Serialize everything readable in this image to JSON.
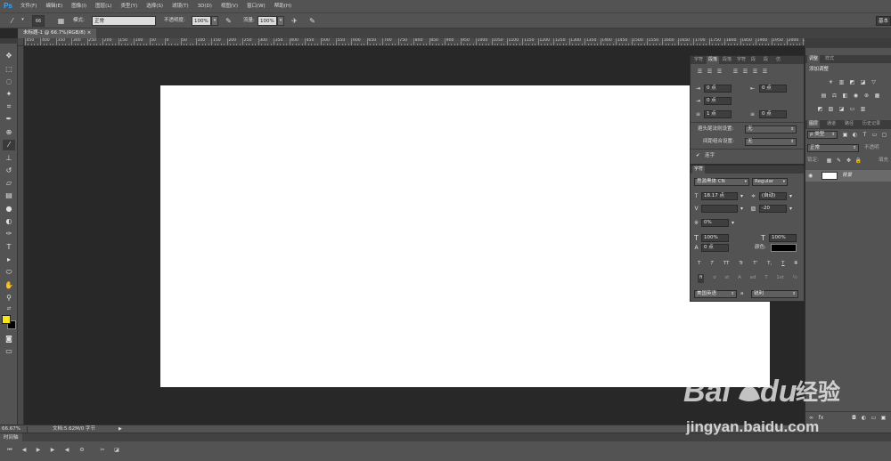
{
  "app": {
    "logo": "Ps"
  },
  "menu": [
    "文件(F)",
    "编辑(E)",
    "图像(I)",
    "图层(L)",
    "类型(Y)",
    "选择(S)",
    "滤镜(T)",
    "3D(D)",
    "视图(V)",
    "窗口(W)",
    "帮助(H)"
  ],
  "options_bar": {
    "brush_size": "66",
    "mode_label": "模式:",
    "mode_value": "正常",
    "opacity_label": "不透明度:",
    "opacity_value": "100%",
    "flow_label": "流量:",
    "flow_value": "100%",
    "workspace_button": "基本"
  },
  "document": {
    "tab_label": "未标题-1 @ 66.7%(RGB/8)",
    "zoom": "66.67%",
    "doc_info": "文档:5.62M/0 字节"
  },
  "ruler": {
    "labels": [
      "450",
      "400",
      "350",
      "300",
      "250",
      "200",
      "150",
      "100",
      "50",
      "0",
      "50",
      "100",
      "150",
      "200",
      "250",
      "300",
      "350",
      "400",
      "450",
      "500",
      "550",
      "600",
      "650",
      "700",
      "750",
      "800",
      "850",
      "900",
      "950",
      "1000",
      "1050",
      "1100",
      "1150",
      "1200",
      "1250",
      "1300",
      "1350",
      "1400",
      "1450",
      "1500",
      "1550",
      "1600",
      "1650",
      "1700",
      "1750",
      "1800",
      "1850",
      "1900",
      "1950",
      "2000",
      "2050",
      "2100",
      "2150",
      "2200",
      "2250",
      "2300"
    ]
  },
  "timeline": {
    "tab": "时间轴"
  },
  "paragraph_panel": {
    "tabs": [
      "字符",
      "段落",
      "段落",
      "字符",
      "段",
      "段",
      "仿"
    ],
    "indent_left": "0 点",
    "indent_right": "0 点",
    "indent_first": "0 点",
    "space_before": "1 点",
    "space_after": "0 点",
    "kinsoku_label": "避头尾法则设置:",
    "kinsoku_value": "无",
    "mojikumi_label": "间距组合设置:",
    "mojikumi_value": "无",
    "hyphenate_label": "连字"
  },
  "character_panel": {
    "tab": "字符",
    "font_family": "思源黑体 CN",
    "font_style": "Regular",
    "font_size": "18.17 点",
    "leading": "(自动)",
    "tracking": "-20",
    "scale_pct": "0%",
    "vertical_scale": "100%",
    "horizontal_scale": "100%",
    "baseline_shift": "0 点",
    "color_label": "颜色:",
    "color": "#000000",
    "styles": [
      "T",
      "T",
      "TT",
      "Tr",
      "T'",
      "T,",
      "T",
      "T"
    ],
    "opentype": [
      "fi",
      "ơ",
      "st",
      "A",
      "ad",
      "T",
      "1st",
      "½"
    ],
    "language": "美国英语",
    "aa_label": "a",
    "antialias": "锐利"
  },
  "adjustments_panel": {
    "tabs": [
      "调整",
      "样式"
    ],
    "title": "添加调整"
  },
  "layers_panel": {
    "tabs": [
      "图层",
      "通道",
      "路径",
      "历史记录"
    ],
    "filter_label": "ρ 类型",
    "blend_mode": "正常",
    "opacity_label": "不透明",
    "lock_label": "锁定:",
    "fill_label": "填充",
    "layer_name": "背景"
  },
  "colors": {
    "foreground": "#f5e71a",
    "background": "#000000",
    "ps_blue": "#31a8ff"
  },
  "watermark": {
    "brand": "Bai",
    "brand2": "du",
    "cn": "经验",
    "url": "jingyan.baidu.com"
  }
}
